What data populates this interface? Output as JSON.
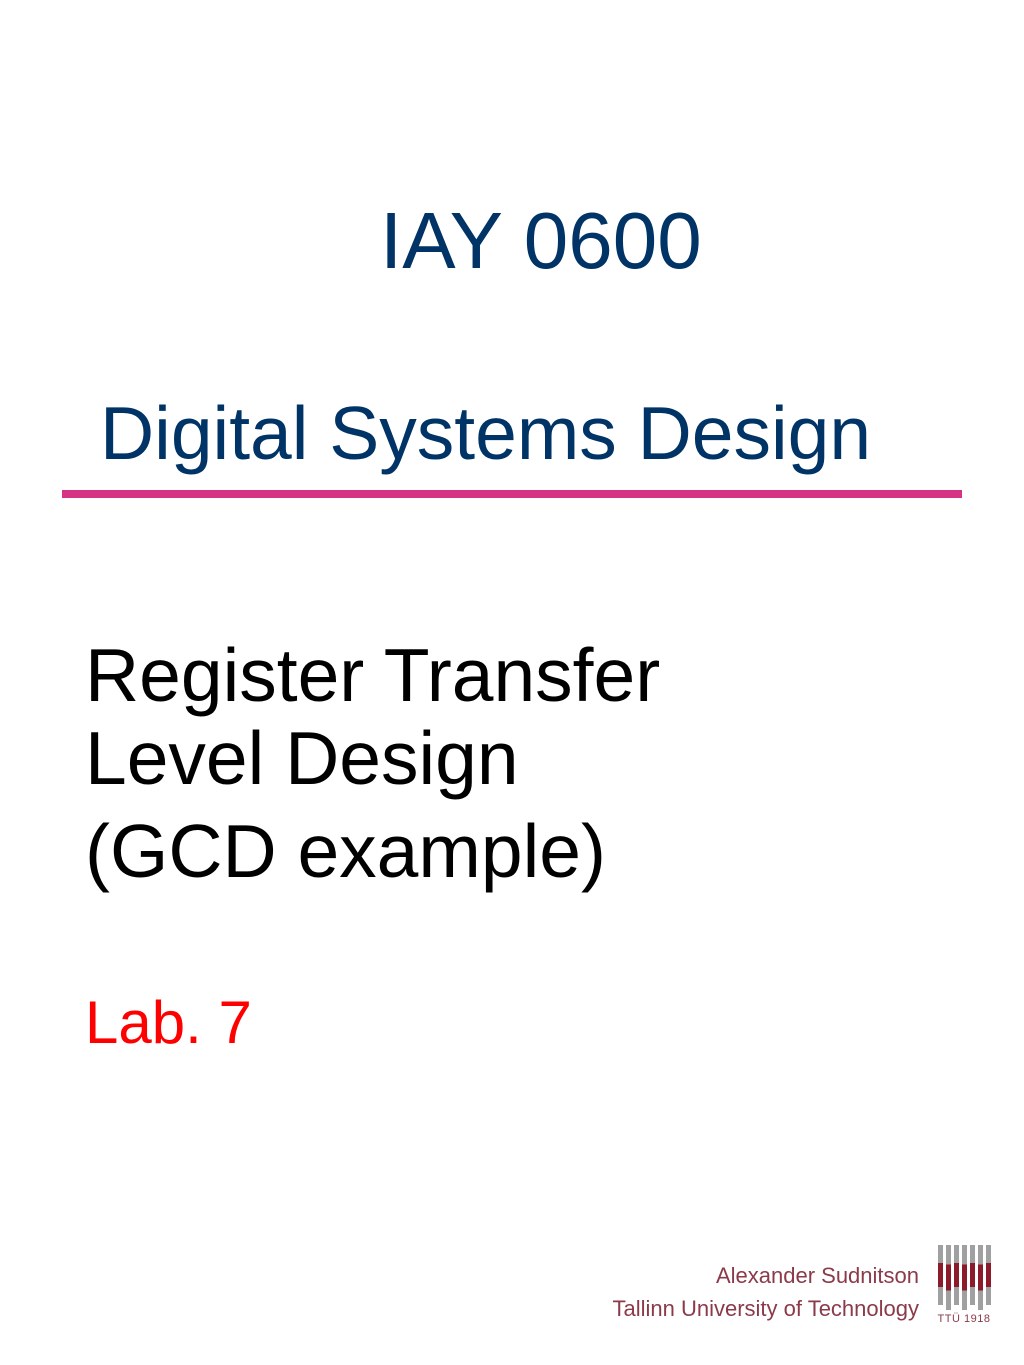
{
  "course_code": "IAY 0600",
  "course_title": "Digital Systems Design",
  "topic": {
    "line1": "Register Transfer",
    "line2": "Level Design",
    "line3": "(GCD example)"
  },
  "lab_label": "Lab. 7",
  "footer": {
    "author": "Alexander Sudnitson",
    "university": "Tallinn University of Technology",
    "logo_year": "TTÜ 1918"
  },
  "colors": {
    "heading": "#003366",
    "divider": "#d63384",
    "lab": "#ff0000",
    "footer_text": "#8b3a4a",
    "logo_dark": "#8b1a2b"
  }
}
